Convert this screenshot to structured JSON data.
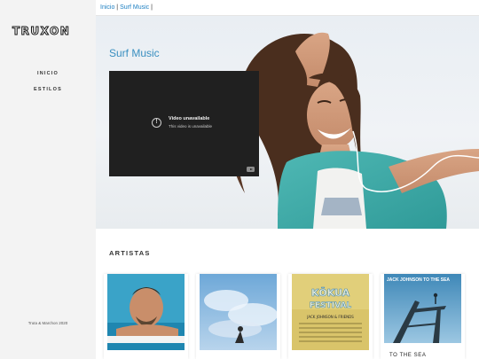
{
  "sidebar": {
    "logo": "TRUXON",
    "nav": [
      "INICIO",
      "ESTILOS"
    ],
    "copyright": "Truta & Marchon 2020"
  },
  "breadcrumb": {
    "items": [
      "Inicio",
      "Surf Music"
    ],
    "separator": "|"
  },
  "hero": {
    "title": "Surf Music",
    "video": {
      "title": "Video unavailable",
      "subtitle": "This video is unavailable"
    }
  },
  "section": {
    "title": "ARTISTAS"
  },
  "albums": [
    {
      "image": "artist-photo-surfer"
    },
    {
      "image": "album-cover-sky-blue"
    },
    {
      "image": "album-cover-kokua-festival",
      "cover_text": [
        "KŌKUA",
        "FESTIVAL",
        "JACK JOHNSON & FRIENDS"
      ]
    },
    {
      "image": "album-cover-to-the-sea",
      "cover_text": "JACK JOHNSON TO THE SEA",
      "label": "TO THE SEA"
    }
  ],
  "colors": {
    "accent": "#1c7fc2",
    "hero_title": "#3a8fc0",
    "sidebar_bg": "#f3f3f3",
    "video_bg": "#202020"
  }
}
